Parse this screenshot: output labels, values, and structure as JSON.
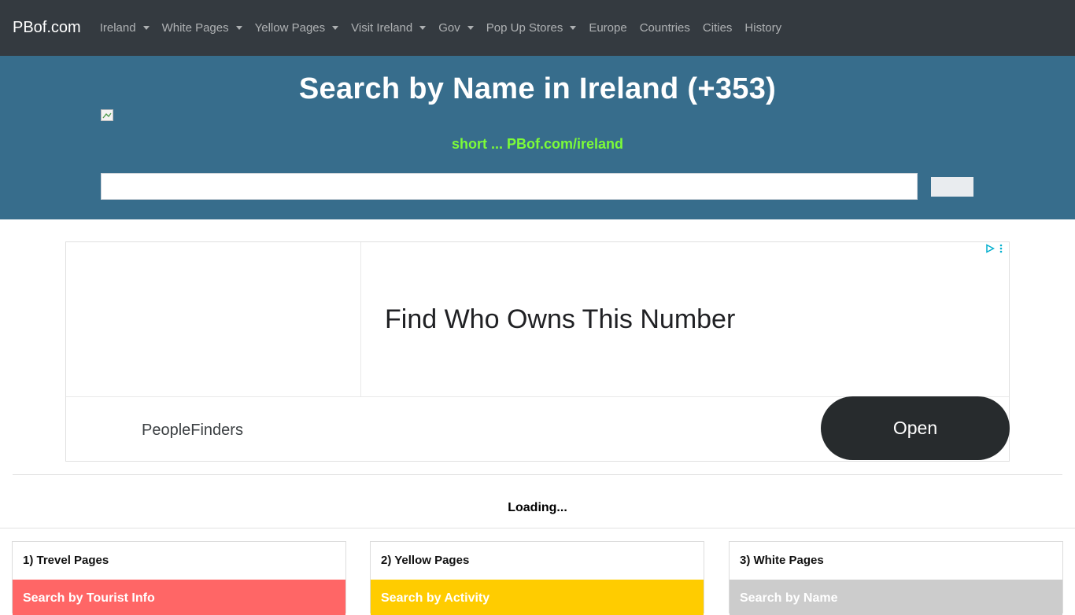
{
  "navbar": {
    "brand": "PBof.com",
    "items": [
      {
        "label": "Ireland",
        "dropdown": true
      },
      {
        "label": "White Pages",
        "dropdown": true
      },
      {
        "label": "Yellow Pages",
        "dropdown": true
      },
      {
        "label": "Visit Ireland",
        "dropdown": true
      },
      {
        "label": "Gov",
        "dropdown": true
      },
      {
        "label": "Pop Up Stores",
        "dropdown": true
      },
      {
        "label": "Europe",
        "dropdown": false
      },
      {
        "label": "Countries",
        "dropdown": false
      },
      {
        "label": "Cities",
        "dropdown": false
      },
      {
        "label": "History",
        "dropdown": false
      }
    ]
  },
  "hero": {
    "title": "Search by Name in Ireland (+353)",
    "short_link": "short ... PBof.com/ireland",
    "search_value": "",
    "search_placeholder": "",
    "search_button_label": ""
  },
  "ad": {
    "headline": "Find Who Owns This Number",
    "advertiser": "PeopleFinders",
    "cta": "Open"
  },
  "status": {
    "loading": "Loading..."
  },
  "cards": [
    {
      "header": "1) Trevel Pages",
      "link": "Search by Tourist Info",
      "color": "#ff6666"
    },
    {
      "header": "2) Yellow Pages",
      "link": "Search by Activity",
      "color": "#ffcc00"
    },
    {
      "header": "3) White Pages",
      "link": "Search by Name",
      "color": "#cccccc"
    }
  ],
  "colors": {
    "navbar_bg": "#343a40",
    "hero_bg": "#376d8c",
    "short_link": "#7cfc38"
  }
}
